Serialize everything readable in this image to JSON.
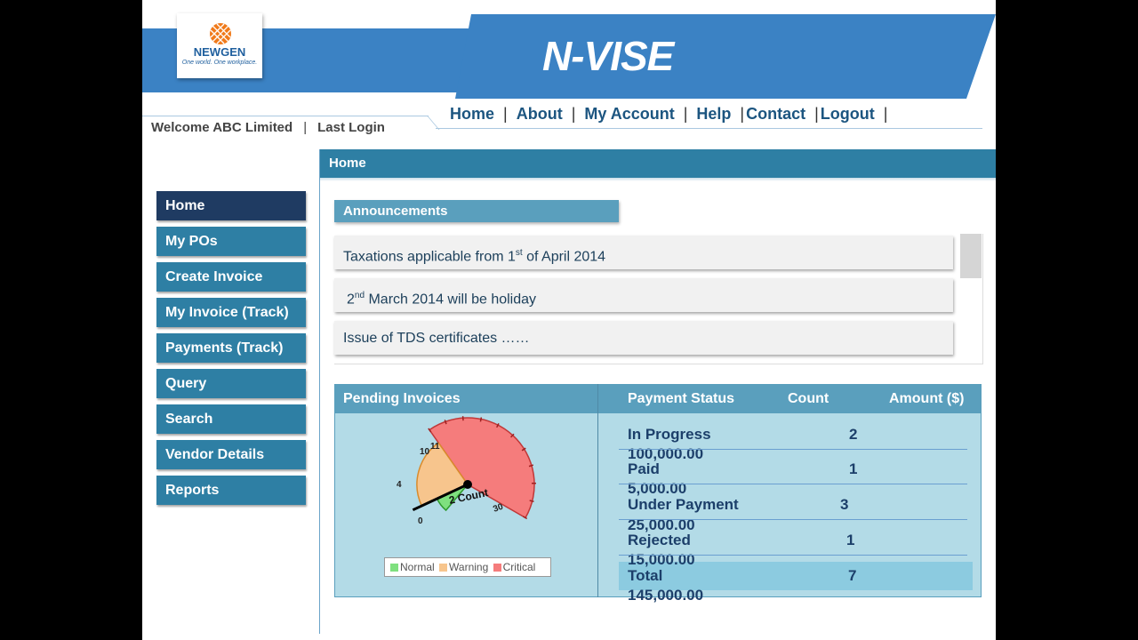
{
  "header": {
    "app_title": "N-VISE",
    "logo": {
      "brand": "NEWGEN",
      "tagline": "One world. One workplace."
    },
    "welcome": "Welcome ABC Limited",
    "last_login": "Last Login"
  },
  "topnav": [
    {
      "label": "Home"
    },
    {
      "label": "About"
    },
    {
      "label": "My Account"
    },
    {
      "label": "Help"
    },
    {
      "label": "Contact"
    },
    {
      "label": "Logout"
    }
  ],
  "content": {
    "title": "Home"
  },
  "sidebar": [
    {
      "label": "Home",
      "active": true
    },
    {
      "label": "My POs"
    },
    {
      "label": "Create Invoice"
    },
    {
      "label": "My Invoice (Track)"
    },
    {
      "label": "Payments (Track)"
    },
    {
      "label": "Query"
    },
    {
      "label": "Search"
    },
    {
      "label": "Vendor Details"
    },
    {
      "label": "Reports"
    }
  ],
  "announcements": {
    "title": "Announcements",
    "items": [
      {
        "pre": "Taxations applicable from 1",
        "sup": "st",
        "post": " of April 2014"
      },
      {
        "pre": "2",
        "sup": "nd",
        "post": " March 2014 will be holiday"
      },
      {
        "pre": "Issue of TDS certificates ……",
        "sup": "",
        "post": ""
      }
    ]
  },
  "pending": {
    "title": "Pending Invoices",
    "columns": [
      "Payment Status",
      "Count",
      "Amount ($)"
    ],
    "rows": [
      {
        "status": "In Progress",
        "count": "2",
        "amount": "100,000.00"
      },
      {
        "status": "Paid",
        "count": "1",
        "amount": "5,000.00"
      },
      {
        "status": "Under Payment",
        "count": "3",
        "amount": "25,000.00"
      },
      {
        "status": "Rejected",
        "count": "1",
        "amount": "15,000.00"
      }
    ],
    "total": {
      "status": "Total",
      "count": "7",
      "amount": "145,000.00"
    }
  },
  "chart_data": {
    "type": "gauge",
    "bands": [
      {
        "name": "Normal",
        "from": 0,
        "to": 2,
        "color": "#3fbf3f"
      },
      {
        "name": "Warning",
        "from": 2,
        "to": 10,
        "color": "#f0a64a"
      },
      {
        "name": "Critical",
        "from": 10,
        "to": 30,
        "color": "#f06a6a"
      }
    ],
    "tick_labels": [
      "0",
      "4",
      "10",
      "11",
      "30"
    ],
    "value": 2,
    "value_label": "2 Count",
    "legend": [
      "Normal",
      "Warning",
      "Critical"
    ]
  },
  "colors": {
    "primary": "#2e7fa4",
    "active": "#1f3b62",
    "header_blue": "#3b82c4",
    "panel_bg": "#b3dbe7"
  }
}
